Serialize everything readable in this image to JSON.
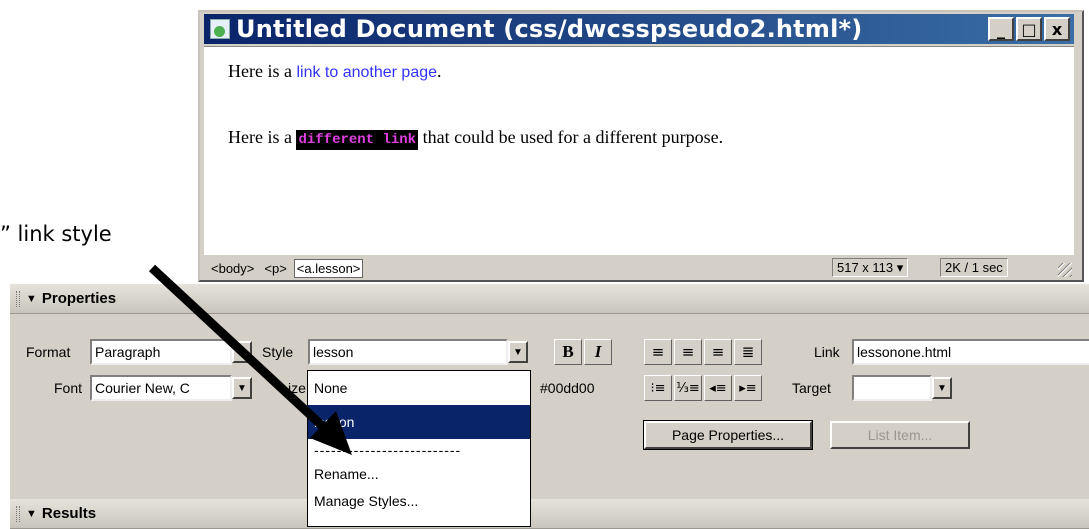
{
  "document_window": {
    "title": "Untitled Document (css/dwcsspseudo2.html*)",
    "buttons": {
      "minimize": "_",
      "maximize": "□",
      "close": "x"
    },
    "content": {
      "para1_prefix": "Here is a ",
      "para1_link": "link to another page",
      "para1_suffix": ".",
      "para2_prefix": "Here is a ",
      "para2_link": "different link",
      "para2_suffix": " that could be used for a different purpose."
    },
    "status": {
      "tags": [
        "<body>",
        "<p>",
        "<a.lesson>"
      ],
      "window_size": "517 x 113 ▾",
      "download": "2K / 1 sec"
    }
  },
  "callout": {
    "text": "” link style"
  },
  "properties": {
    "title": "Properties",
    "format_label": "Format",
    "format_value": "Paragraph",
    "style_label": "Style",
    "style_value": "lesson",
    "font_label": "Font",
    "font_value": "Courier New, C",
    "size_label": "ize",
    "color_value": "#00dd00",
    "bold": "B",
    "italic": "I",
    "link_label": "Link",
    "link_value": "lessonone.html",
    "target_label": "Target",
    "target_value": "",
    "page_properties": "Page Properties...",
    "list_item": "List Item..."
  },
  "results": {
    "title": "Results"
  },
  "style_dropdown": {
    "items": [
      "None",
      "lesson",
      "--------------------------",
      "Rename...",
      "Manage Styles..."
    ],
    "selected": "lesson"
  }
}
